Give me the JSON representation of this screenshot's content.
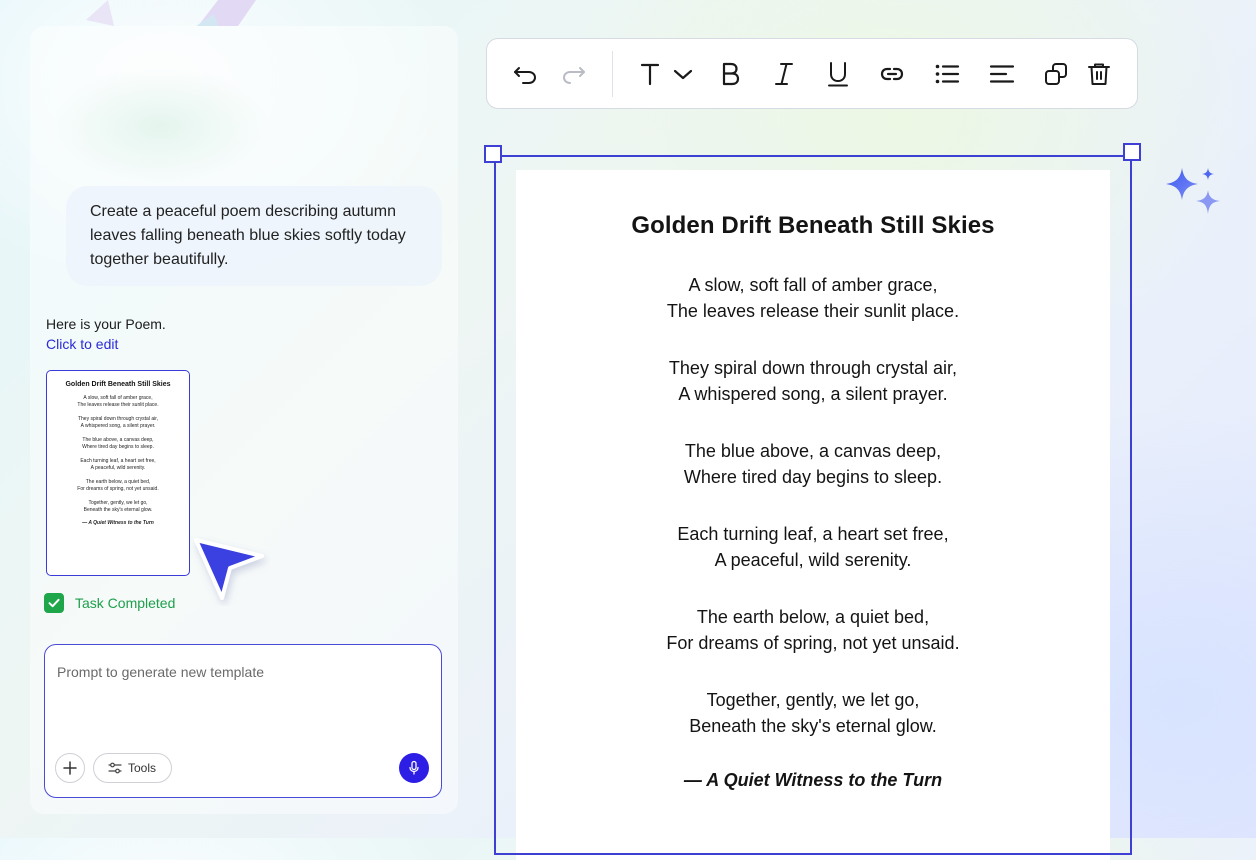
{
  "chat": {
    "user_prompt": "Create a peaceful poem describing autumn leaves falling beneath blue skies softly today together beautifully.",
    "reply_text": "Here is your Poem.",
    "edit_link": "Click to edit",
    "task_status": "Task Completed",
    "prompt_placeholder": "Prompt to generate new template",
    "tools_label": "Tools"
  },
  "toolbar": {
    "icons": [
      "undo-icon",
      "redo-icon",
      "text-style-icon",
      "chevron-down-icon",
      "bold-icon",
      "italic-icon",
      "underline-icon",
      "link-icon",
      "bulleted-list-icon",
      "align-left-icon",
      "duplicate-icon",
      "delete-icon"
    ]
  },
  "poem": {
    "title": "Golden Drift Beneath Still Skies",
    "stanzas": [
      [
        "A slow, soft fall of amber grace,",
        "The leaves release their sunlit place."
      ],
      [
        "They spiral down through crystal air,",
        "A whispered song, a silent prayer."
      ],
      [
        "The blue above, a canvas deep,",
        "Where tired day begins to sleep."
      ],
      [
        "Each turning leaf, a heart set free,",
        "A peaceful, wild serenity."
      ],
      [
        "The earth below, a quiet bed,",
        "For dreams of spring, not yet unsaid."
      ],
      [
        "Together, gently, we let go,",
        "Beneath the sky's eternal glow."
      ]
    ],
    "signature": "— A Quiet Witness to the Turn"
  },
  "colors": {
    "accent": "#3d40d3",
    "success": "#1fa64a",
    "mic": "#2d1ee6",
    "link": "#2b2bd8"
  }
}
